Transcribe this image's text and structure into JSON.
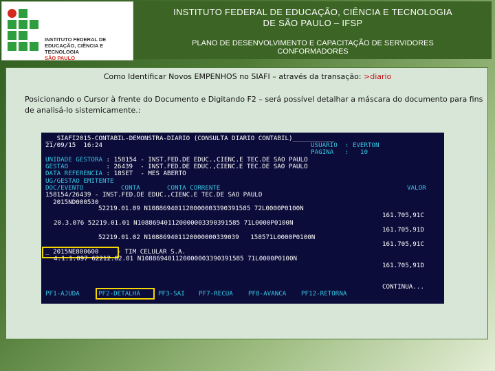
{
  "header": {
    "logo": {
      "line1": "INSTITUTO FEDERAL DE",
      "line2": "EDUCAÇÃO, CIÊNCIA E TECNOLOGIA",
      "line3": "SÃO PAULO"
    },
    "title_line1": "INSTITUTO FEDERAL DE EDUCAÇÃO, CIÊNCIA E TECNOLOGIA",
    "title_line2": "DE SÃO PAULO – IFSP",
    "subtitle_line1": "PLANO DE DESENVOLVIMENTO E CAPACITAÇÃO DE SERVIDORES",
    "subtitle_line2": "CONFORMADORES"
  },
  "panel": {
    "title": "Como Identificar Novos EMPENHOS no SIAFI – através da transação: ",
    "title_highlight": ">diario",
    "description": "Posicionando o Cursor à frente do Documento e Digitando F2 – será possível detalhar a máscara do documento para fins de analisá-lo sistemicamente.:"
  },
  "terminal": {
    "l1": "__ SIAFI2015-CONTABIL-DEMONSTRA-DIARIO (CONSULTA DIARIO CONTABIL)___________",
    "l2": "21/09/15  16:24",
    "l2b": "USUARIO  : EVERTON",
    "l3b": "PAGINA   :   10",
    "l4a": "UNIDADE GESTORA",
    "l4b": " : 158154 - INST.FED.DE EDUC.,CIENC.E TEC.DE SAO PAULO",
    "l5a": "GESTAO",
    "l5b": "          : 26439  - INST.FED.DE EDUC.,CIENC.E TEC.DE SAO PAULO",
    "l6a": "DATA REFERENCIA",
    "l6b": " : 18SET  - MES ABERTO",
    "l7": "UG/GESTAO EMITENTE",
    "l8a": "DOC/EVENTO",
    "l8b": "CONTA",
    "l8c": "CONTA CORRENTE",
    "l8d": "VALOR",
    "l9": "158154/26439 - INST.FED.DE EDUC.,CIENC.E TEC.DE SAO PAULO",
    "l10": "  2015ND000530",
    "r1a": "52219.01.09 N108869401120000003390391585 72L0000P0100N",
    "r1b": "161.705,91C",
    "r2a": "20.3.076 52219.01.01 N108869401120000003390391585 71L0000P0100N",
    "r2b": "161.705,91D",
    "r3a": "52219.01.02 N108869401120000000339039   158571L0000P0100N",
    "r3b": "161.705,91C",
    "r4a": "_ 2015NE800600",
    "r4b": " - TIM CELULAR S.A.",
    "r5a": "4.1.1.097 62212.02.01 N108869401120000003390391585 71L0000P0100N",
    "r5b": "161.705,91D",
    "cont": "CONTINUA...",
    "pf1": "PF1-AJUDA",
    "pf2": "PF2-DETALHA",
    "pf3": "PF3-SAI",
    "pf7": "PF7-RECUA",
    "pf8": "PF8-AVANCA",
    "pf12": "PF12-RETORNA"
  }
}
